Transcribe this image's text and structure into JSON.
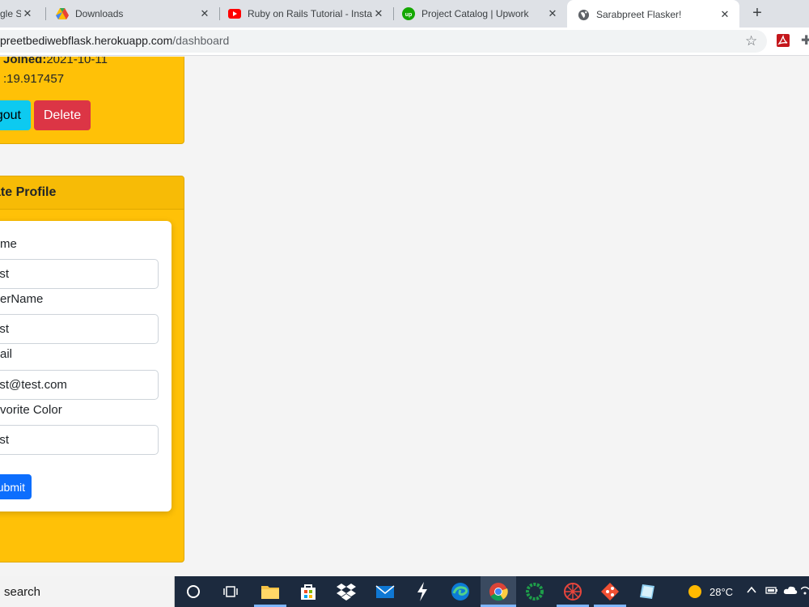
{
  "browser": {
    "tabs": [
      {
        "title": "gle Se",
        "icon": "google-icon"
      },
      {
        "title": "Downloads",
        "icon": "google-drive-icon"
      },
      {
        "title": "Ruby on Rails Tutorial - Insta",
        "icon": "youtube-icon"
      },
      {
        "title": "Project Catalog | Upwork",
        "icon": "upwork-icon"
      },
      {
        "title": "Sarabpreet Flasker!",
        "icon": "globe-icon",
        "active": true
      }
    ],
    "new_tab": "+",
    "url_host": "preetbediwebflask.herokuapp.com",
    "url_path": "/dashboard"
  },
  "profile": {
    "joined_label": "Joined:",
    "joined_value": "2021-10-11",
    "time_value": ":19.917457",
    "logout_label": "gout",
    "delete_label": "Delete"
  },
  "update_profile": {
    "title": "ate Profile",
    "fields": [
      {
        "label": "me",
        "value": "est"
      },
      {
        "label": "erName",
        "value": "est"
      },
      {
        "label": "ail",
        "value": "est@test.com"
      },
      {
        "label": "vorite Color",
        "value": "est"
      }
    ],
    "submit_label": "ubmit"
  },
  "taskbar": {
    "search_text": " search",
    "temperature": "28°C"
  },
  "colors": {
    "card_yellow": "#ffc107",
    "delete_red": "#dc3545",
    "logout_cyan": "#0dcaf0",
    "submit_blue": "#0d6efd",
    "taskbar": "#1c2a3e"
  }
}
